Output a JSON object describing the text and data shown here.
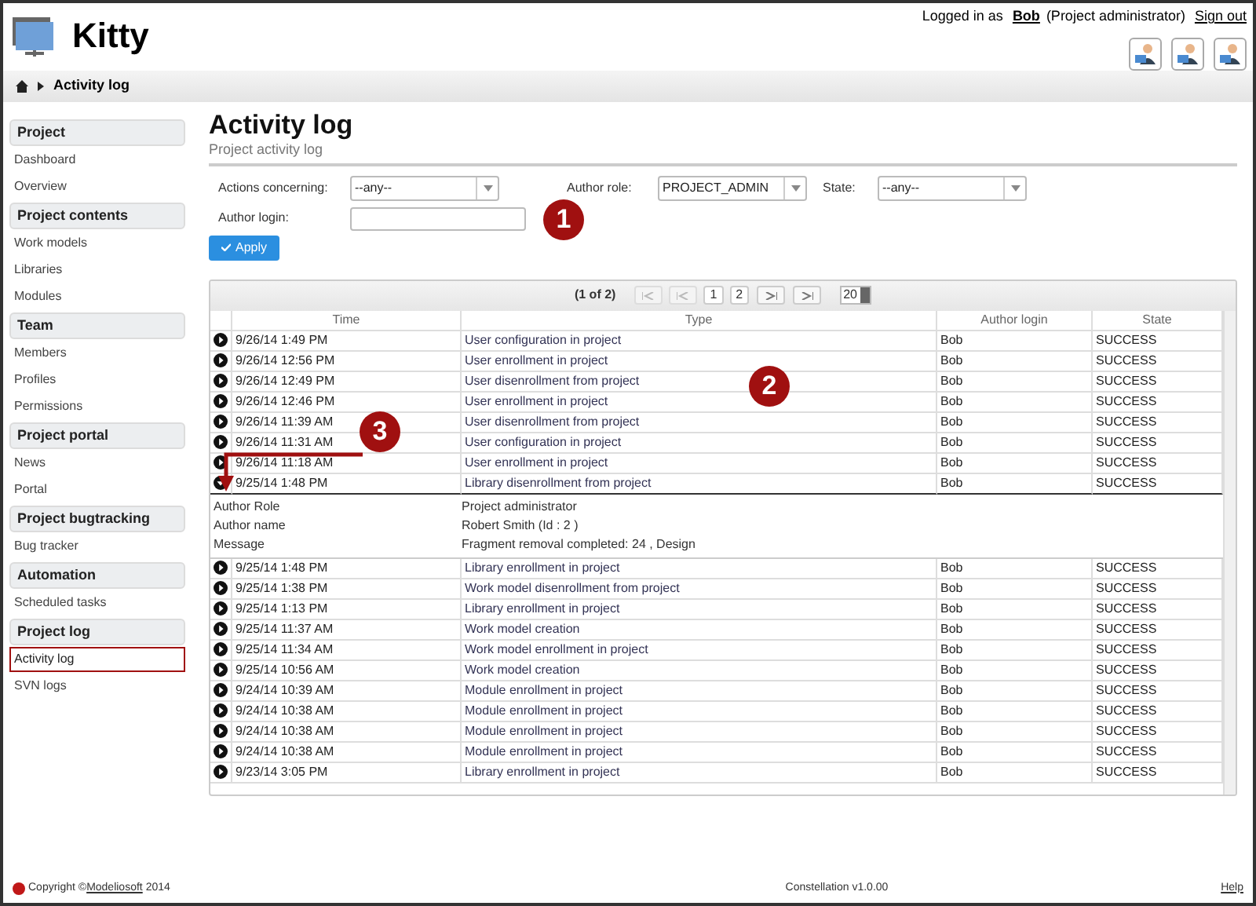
{
  "app": {
    "title": "Kitty"
  },
  "user_bar": {
    "prefix": "Logged in as",
    "user": "Bob",
    "role": "(Project administrator)",
    "sign_out": "Sign out"
  },
  "breadcrumb": {
    "current": "Activity log"
  },
  "sidebar": [
    {
      "title": "Project",
      "items": [
        {
          "label": "Dashboard",
          "selected": false
        },
        {
          "label": "Overview",
          "selected": false
        }
      ]
    },
    {
      "title": "Project contents",
      "items": [
        {
          "label": "Work models",
          "selected": false
        },
        {
          "label": "Libraries",
          "selected": false
        },
        {
          "label": "Modules",
          "selected": false
        }
      ]
    },
    {
      "title": "Team",
      "items": [
        {
          "label": "Members",
          "selected": false
        },
        {
          "label": "Profiles",
          "selected": false
        },
        {
          "label": "Permissions",
          "selected": false
        }
      ]
    },
    {
      "title": "Project portal",
      "items": [
        {
          "label": "News",
          "selected": false
        },
        {
          "label": "Portal",
          "selected": false
        }
      ]
    },
    {
      "title": "Project bugtracking",
      "items": [
        {
          "label": "Bug tracker",
          "selected": false
        }
      ]
    },
    {
      "title": "Automation",
      "items": [
        {
          "label": "Scheduled tasks",
          "selected": false
        }
      ]
    },
    {
      "title": "Project log",
      "items": [
        {
          "label": "Activity log",
          "selected": true
        },
        {
          "label": "SVN logs",
          "selected": false
        }
      ]
    }
  ],
  "page": {
    "title": "Activity log",
    "subtitle": "Project activity log"
  },
  "filters": {
    "actions_label": "Actions concerning:",
    "actions_value": "--any--",
    "role_label": "Author role:",
    "role_value": "PROJECT_ADMIN",
    "state_label": "State:",
    "state_value": "--any--",
    "login_label": "Author login:",
    "apply": "Apply"
  },
  "pager": {
    "summary": "(1 of 2)",
    "pages": [
      "1",
      "2"
    ],
    "page_size": "20"
  },
  "table": {
    "columns": [
      "Time",
      "Type",
      "Author login",
      "State"
    ],
    "rows": [
      {
        "time": "9/26/14 1:49 PM",
        "type": "User configuration in project",
        "author": "Bob",
        "state": "SUCCESS",
        "expanded": false
      },
      {
        "time": "9/26/14 12:56 PM",
        "type": "User enrollment in project",
        "author": "Bob",
        "state": "SUCCESS",
        "expanded": false
      },
      {
        "time": "9/26/14 12:49 PM",
        "type": "User disenrollment from project",
        "author": "Bob",
        "state": "SUCCESS",
        "expanded": false
      },
      {
        "time": "9/26/14 12:46 PM",
        "type": "User enrollment in project",
        "author": "Bob",
        "state": "SUCCESS",
        "expanded": false
      },
      {
        "time": "9/26/14 11:39 AM",
        "type": "User disenrollment from project",
        "author": "Bob",
        "state": "SUCCESS",
        "expanded": false
      },
      {
        "time": "9/26/14 11:31 AM",
        "type": "User configuration in project",
        "author": "Bob",
        "state": "SUCCESS",
        "expanded": false
      },
      {
        "time": "9/26/14 11:18 AM",
        "type": "User enrollment in project",
        "author": "Bob",
        "state": "SUCCESS",
        "expanded": false
      },
      {
        "time": "9/25/14 1:48 PM",
        "type": "Library disenrollment from project",
        "author": "Bob",
        "state": "SUCCESS",
        "expanded": true,
        "details": [
          {
            "label": "Author Role",
            "value": "Project administrator"
          },
          {
            "label": "Author name",
            "value": "Robert Smith (Id : 2 )"
          },
          {
            "label": "Message",
            "value": "Fragment removal completed: 24 , Design"
          }
        ]
      },
      {
        "time": "9/25/14 1:48 PM",
        "type": "Library enrollment in project",
        "author": "Bob",
        "state": "SUCCESS",
        "expanded": false
      },
      {
        "time": "9/25/14 1:38 PM",
        "type": "Work model disenrollment from project",
        "author": "Bob",
        "state": "SUCCESS",
        "expanded": false
      },
      {
        "time": "9/25/14 1:13 PM",
        "type": "Library enrollment in project",
        "author": "Bob",
        "state": "SUCCESS",
        "expanded": false
      },
      {
        "time": "9/25/14 11:37 AM",
        "type": "Work model creation",
        "author": "Bob",
        "state": "SUCCESS",
        "expanded": false
      },
      {
        "time": "9/25/14 11:34 AM",
        "type": "Work model enrollment in project",
        "author": "Bob",
        "state": "SUCCESS",
        "expanded": false
      },
      {
        "time": "9/25/14 10:56 AM",
        "type": "Work model creation",
        "author": "Bob",
        "state": "SUCCESS",
        "expanded": false
      },
      {
        "time": "9/24/14 10:39 AM",
        "type": "Module enrollment in project",
        "author": "Bob",
        "state": "SUCCESS",
        "expanded": false
      },
      {
        "time": "9/24/14 10:38 AM",
        "type": "Module enrollment in project",
        "author": "Bob",
        "state": "SUCCESS",
        "expanded": false
      },
      {
        "time": "9/24/14 10:38 AM",
        "type": "Module enrollment in project",
        "author": "Bob",
        "state": "SUCCESS",
        "expanded": false
      },
      {
        "time": "9/24/14 10:38 AM",
        "type": "Module enrollment in project",
        "author": "Bob",
        "state": "SUCCESS",
        "expanded": false
      },
      {
        "time": "9/23/14 3:05 PM",
        "type": "Library enrollment in project",
        "author": "Bob",
        "state": "SUCCESS",
        "expanded": false
      }
    ]
  },
  "callouts": [
    "1",
    "2",
    "3"
  ],
  "footer": {
    "copyright_prefix": "Copyright ©",
    "company": "Modeliosoft",
    "year": "2014",
    "version": "Constellation v1.0.00",
    "help": "Help"
  }
}
